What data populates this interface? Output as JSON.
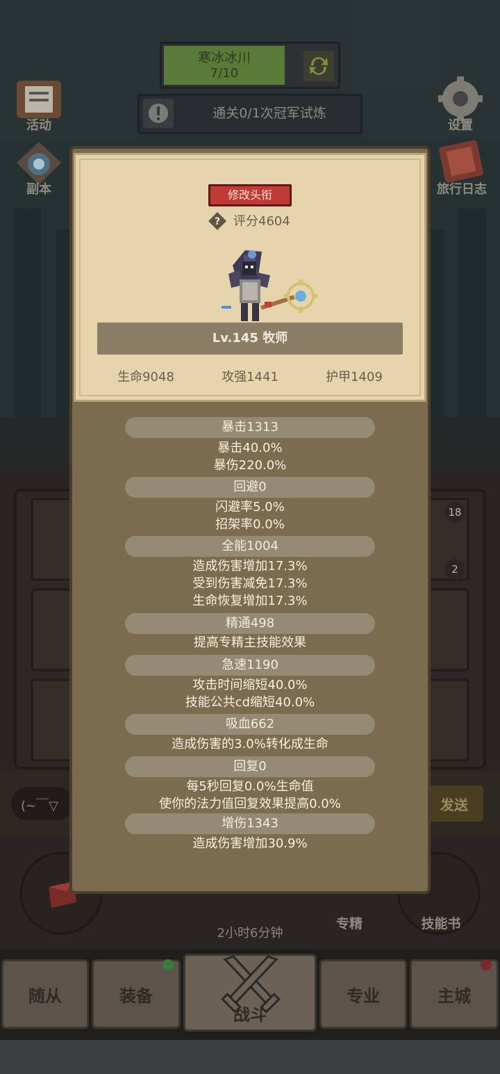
{
  "hud": {
    "stage_name": "寒冰冰川",
    "stage_progress": "7/10",
    "quest_text": "通关0/1次冠军试炼",
    "left_menu": [
      "活动",
      "副本"
    ],
    "right_menu": [
      "设置",
      "旅行日志"
    ],
    "chat_placeholder": "(~￣▽",
    "send_label": "发送",
    "timer": "2小时6分钟",
    "skill_buttons": [
      "专精",
      "技能书"
    ],
    "side_badges": [
      "18",
      "2"
    ]
  },
  "nav": {
    "items": [
      "随从",
      "装备",
      "战斗",
      "专业",
      "主城"
    ]
  },
  "profile": {
    "rename_button": "修改头衔",
    "score": "评分4604",
    "level_class": "Lv.145 牧师",
    "stats": [
      "生命9048",
      "攻强1441",
      "护甲1409"
    ]
  },
  "attributes": [
    {
      "title": "暴击1313",
      "lines": [
        "暴击40.0%",
        "暴伤220.0%"
      ]
    },
    {
      "title": "回避0",
      "lines": [
        "闪避率5.0%",
        "招架率0.0%"
      ]
    },
    {
      "title": "全能1004",
      "lines": [
        "造成伤害增加17.3%",
        "受到伤害减免17.3%",
        "生命恢复增加17.3%"
      ]
    },
    {
      "title": "精通498",
      "lines": [
        "提高专精主技能效果"
      ]
    },
    {
      "title": "急速1190",
      "lines": [
        "攻击时间缩短40.0%",
        "技能公共cd缩短40.0%"
      ]
    },
    {
      "title": "吸血662",
      "lines": [
        "造成伤害的3.0%转化成生命"
      ]
    },
    {
      "title": "回复0",
      "lines": [
        "每5秒回复0.0%生命值",
        "使你的法力值回复效果提高0.0%"
      ]
    },
    {
      "title": "增伤1343",
      "lines": [
        "造成伤害增加30.9%"
      ]
    }
  ],
  "colors": {
    "modal_bg": "#7b6b4f",
    "card_bg": "#e6d4ad",
    "rename_red": "#c23a35",
    "stage_green": "#5a7a37"
  }
}
